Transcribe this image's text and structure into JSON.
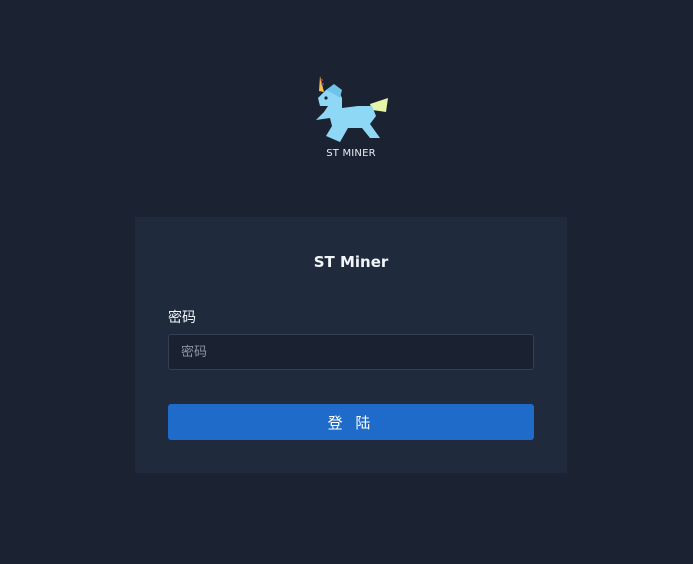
{
  "logo": {
    "icon": "unicorn-icon",
    "text": "ST MINER"
  },
  "login": {
    "title": "ST Miner",
    "password_label": "密码",
    "password_placeholder": "密码",
    "password_value": "",
    "submit_label": "登 陆"
  },
  "colors": {
    "background": "#1b2333",
    "card": "#1f2a3c",
    "button": "#1f6bca",
    "unicorn_body": "#8fd8f5",
    "unicorn_tail": "#e6f5a8"
  }
}
